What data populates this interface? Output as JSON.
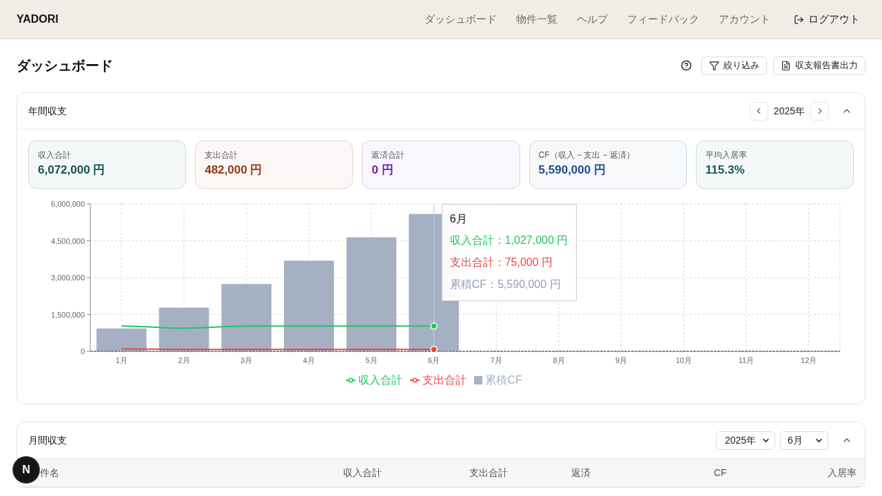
{
  "header": {
    "logo": "YADORI",
    "nav": [
      {
        "label": "ダッシュボード"
      },
      {
        "label": "物件一覧"
      },
      {
        "label": "ヘルプ"
      },
      {
        "label": "フィードバック"
      },
      {
        "label": "アカウント"
      }
    ],
    "logout": "ログアウト"
  },
  "page": {
    "title": "ダッシュボード",
    "actions": [
      {
        "label": "絞り込み",
        "kind": "filter"
      },
      {
        "label": "収支報告書出力",
        "kind": "report"
      }
    ]
  },
  "annual": {
    "title": "年間収支",
    "expanded": true,
    "year": "2025年",
    "summary": [
      {
        "label": "収入合計",
        "value": "6,072,000 円",
        "color": "#0f5547"
      },
      {
        "label": "支出合計",
        "value": "482,000 円",
        "color": "#9a3412"
      },
      {
        "label": "返済合計",
        "value": "0 円",
        "color": "#6b21a8"
      },
      {
        "label": "CF（収入 − 支出 − 返済）",
        "value": "5,590,000 円",
        "color": "#1d4e89"
      },
      {
        "label": "平均入居率",
        "value": "115.3%",
        "color": "#0d5c4f"
      }
    ],
    "chart_data": {
      "type": "bar",
      "categories": [
        "1月",
        "2月",
        "3月",
        "4月",
        "5月",
        "6月",
        "7月",
        "8月",
        "9月",
        "10月",
        "11月",
        "12月"
      ],
      "series": [
        {
          "name": "収入合計",
          "type": "line",
          "color": "#22c55e",
          "values": [
            1030000,
            940000,
            1030000,
            1030000,
            1030000,
            1027000,
            null,
            null,
            null,
            null,
            null,
            null
          ]
        },
        {
          "name": "支出合計",
          "type": "line",
          "color": "#ef4444",
          "values": [
            100000,
            80000,
            80000,
            80000,
            80000,
            75000,
            null,
            null,
            null,
            null,
            null,
            null
          ]
        },
        {
          "name": "累積CF",
          "color": "#a5b0c3",
          "values": [
            930000,
            1780000,
            2740000,
            3690000,
            4640000,
            5590000,
            null,
            null,
            null,
            null,
            null,
            null
          ]
        }
      ],
      "ylim": [
        0,
        6000000
      ],
      "yticks": [
        {
          "value": 0,
          "label": "0"
        },
        {
          "value": 1500000,
          "label": "1,500,000"
        },
        {
          "value": 3000000,
          "label": "3,000,000"
        },
        {
          "value": 4500000,
          "label": "4,500,000"
        },
        {
          "value": 6000000,
          "label": "6,000,000"
        }
      ],
      "grid": true,
      "legend": true,
      "ref_lines": [
        {
          "axis": "x",
          "value": "6月"
        }
      ]
    },
    "tooltip": {
      "title": "6月",
      "rows": [
        {
          "text": "収入合計：1,027,000 円",
          "color": "#22c55e"
        },
        {
          "text": "支出合計：75,000 円",
          "color": "#ef4444"
        },
        {
          "text": "累積CF：5,590,000 円",
          "color": "#94a0b8"
        }
      ]
    }
  },
  "monthly": {
    "title": "月間収支",
    "expanded": true,
    "year": "2025年",
    "month": "6月",
    "columns": [
      "件名",
      "収入合計",
      "支出合計",
      "返済",
      "CF",
      "入居率"
    ]
  },
  "dev_badge": "N"
}
